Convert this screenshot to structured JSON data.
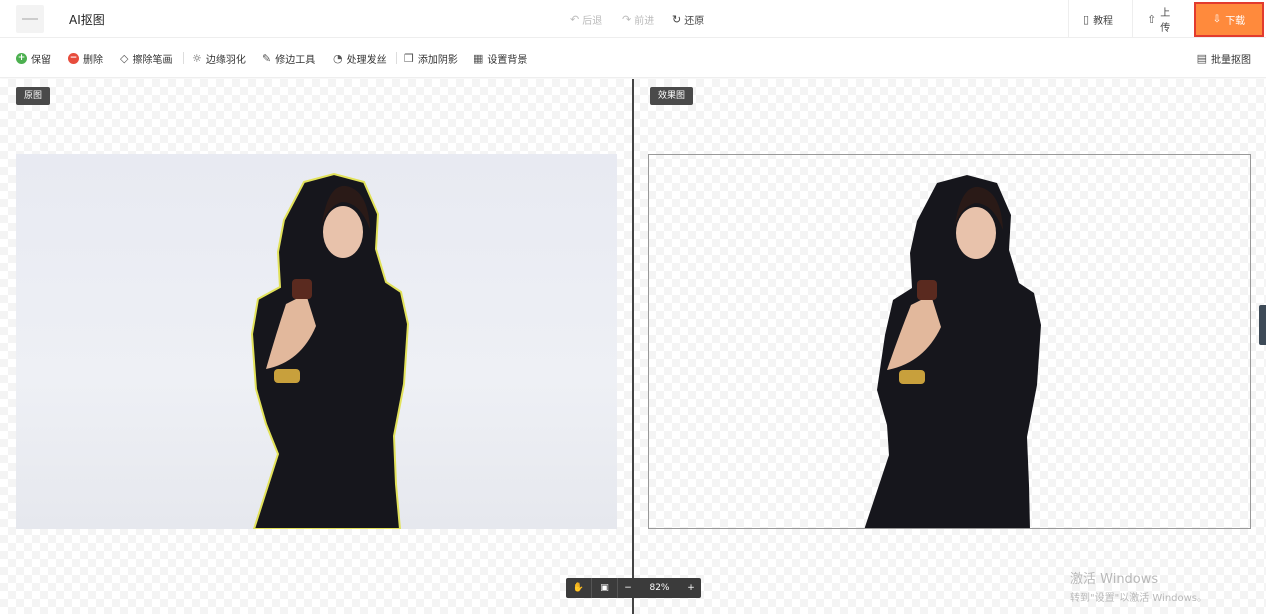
{
  "header": {
    "title": "AI抠图",
    "undo": "后退",
    "redo": "前进",
    "restore": "还原",
    "tutorial": "教程",
    "upload": "上传",
    "download": "下载"
  },
  "toolbar": {
    "keep": "保留",
    "delete": "删除",
    "erase": "擦除笔画",
    "feather": "边缘羽化",
    "edge_tool": "修边工具",
    "hair": "处理发丝",
    "shadow": "添加阴影",
    "background": "设置背景",
    "batch": "批量抠图"
  },
  "panels": {
    "original_label": "原图",
    "result_label": "效果图"
  },
  "zoom": {
    "level": "82%",
    "minus": "−",
    "plus": "+"
  },
  "watermark": {
    "line1": "激活 Windows",
    "line2": "转到\"设置\"以激活 Windows。"
  },
  "colors": {
    "download_bg": "#ff8a3c",
    "download_border": "#e23b2e",
    "keep_icon": "#4cb050",
    "delete_icon": "#e74c3c"
  }
}
